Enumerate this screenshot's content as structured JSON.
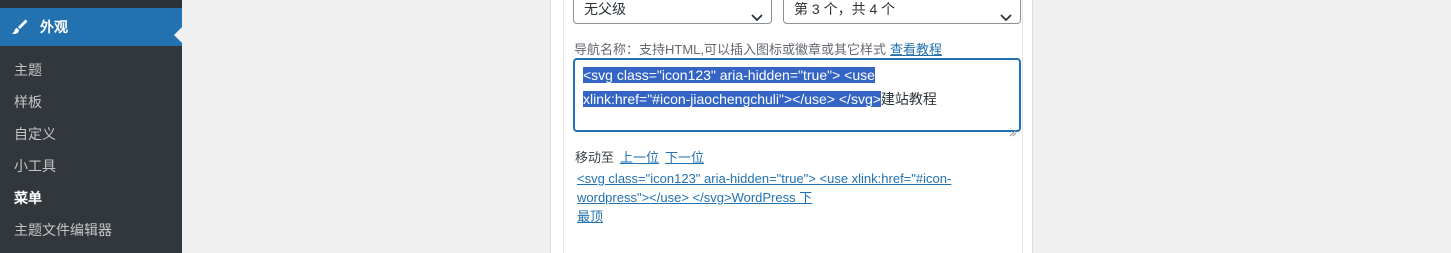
{
  "sidebar": {
    "active_menu": {
      "label": "外观",
      "icon": "paintbrush-icon"
    },
    "items": [
      {
        "label": "主题",
        "current": false
      },
      {
        "label": "样板",
        "current": false
      },
      {
        "label": "自定义",
        "current": false
      },
      {
        "label": "小工具",
        "current": false
      },
      {
        "label": "菜单",
        "current": true
      },
      {
        "label": "主题文件编辑器",
        "current": false
      }
    ]
  },
  "form": {
    "parent_select": {
      "value": "无父级"
    },
    "order_select": {
      "value": "第 3 个，共 4 个"
    },
    "nav_label": "导航名称：支持HTML,可以插入图标或徽章或其它样式",
    "nav_label_link": "查看教程",
    "textarea": {
      "selected_text_line1": "<svg class=\"icon123\" aria-hidden=\"true\"> <use",
      "selected_text_line2": "xlink:href=\"#icon-jiaochengchuli\"></use> </svg>",
      "trailing_text": "建站教程"
    },
    "move_label": "移动至",
    "move_up": "上一位",
    "move_down": "下一位",
    "original_line1": "<svg class=\"icon123\" aria-hidden=\"true\"> <use xlink:href=\"#icon-",
    "original_line2": "wordpress\"></use> </svg>WordPress 下",
    "original_line3": "最顶"
  },
  "colors": {
    "sidebar_bg": "#2c3338",
    "submenu_bg": "#32373c",
    "accent": "#2271b1",
    "selection": "#3465c4"
  }
}
